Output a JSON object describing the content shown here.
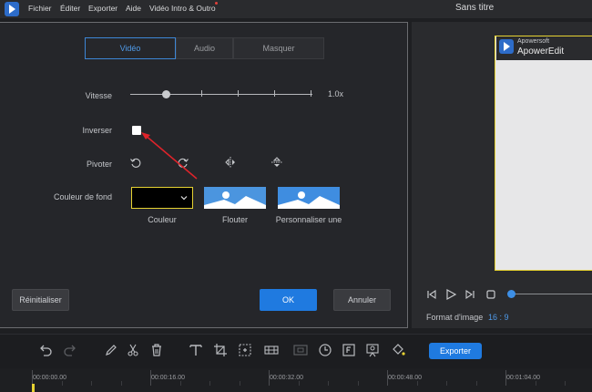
{
  "titlebar": {
    "menus": [
      "Fichier",
      "Éditer",
      "Exporter",
      "Aide",
      "Vidéo Intro & Outro"
    ],
    "window_title": "Sans titre"
  },
  "dialog": {
    "tabs": [
      {
        "label": "Vidéo",
        "active": true
      },
      {
        "label": "Audio",
        "active": false
      },
      {
        "label": "Masquer",
        "active": false
      }
    ],
    "speed": {
      "label": "Vitesse",
      "value_text": "1.0x",
      "value_fraction": 0.2
    },
    "reverse": {
      "label": "Inverser",
      "checked": false
    },
    "rotate": {
      "label": "Pivoter"
    },
    "background": {
      "label": "Couleur de fond",
      "options": [
        {
          "label": "Couleur",
          "color": "#000000"
        },
        {
          "label": "Flouter"
        },
        {
          "label": "Personnaliser une"
        }
      ]
    },
    "buttons": {
      "reset": "Réinitialiser",
      "ok": "OK",
      "cancel": "Annuler"
    }
  },
  "preview": {
    "watermark_small": "Apowersoft",
    "watermark_big": "ApowerEdit",
    "ratio_label": "Format d'image",
    "ratio_value": "16 : 9",
    "progress_fraction": 0.0
  },
  "toolbar": {
    "export_label": "Exporter",
    "tools": [
      "undo-icon",
      "redo-icon",
      "pencil-icon",
      "scissors-icon",
      "trash-icon",
      "text-icon",
      "crop-icon",
      "zoom-icon",
      "mosaic-icon",
      "freeze-icon",
      "duration-icon",
      "snapshot-icon",
      "speed-icon",
      "fill-icon"
    ]
  },
  "timeline": {
    "timecodes": [
      "00:00:00.00",
      "00:00:16.00",
      "00:00:32.00",
      "00:00:48.00",
      "00:01:04.00"
    ]
  },
  "colors": {
    "accent": "#1f7ae0",
    "highlight": "#e6d232",
    "arrow": "#e0232a"
  }
}
